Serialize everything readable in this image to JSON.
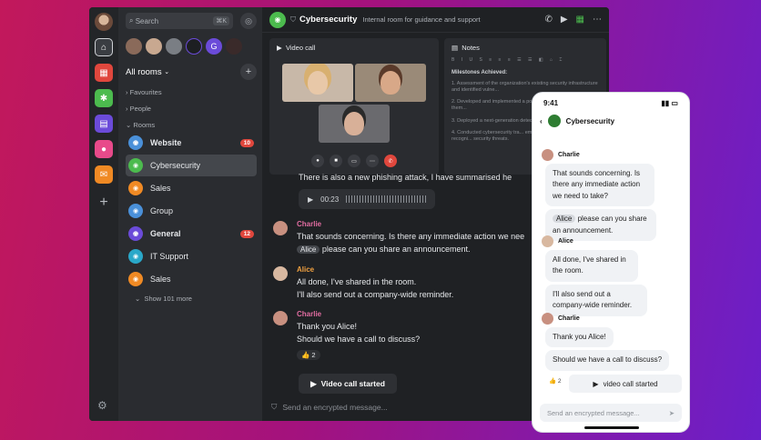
{
  "roomlist": {
    "search_placeholder": "Search",
    "search_shortcut": "⌘K",
    "all_rooms_label": "All rooms",
    "sections": {
      "favourites": "Favourites",
      "people": "People",
      "rooms": "Rooms"
    },
    "recent_g": "G",
    "rooms": [
      {
        "name": "Website",
        "badge": "10",
        "color": "#4a90d9",
        "bold": true
      },
      {
        "name": "Cybersecurity",
        "badge": "",
        "color": "#4cbb4e",
        "active": true
      },
      {
        "name": "Sales",
        "badge": "",
        "color": "#f08a24"
      },
      {
        "name": "Group",
        "badge": "",
        "color": "#4a90d9"
      },
      {
        "name": "General",
        "badge": "12",
        "color": "#6b4bd9",
        "bold": true
      },
      {
        "name": "IT Support",
        "badge": "",
        "color": "#2aa8c9"
      },
      {
        "name": "Sales",
        "badge": "",
        "color": "#f08a24"
      }
    ],
    "show_more": "Show 101 more"
  },
  "header": {
    "room_name": "Cybersecurity",
    "topic": "Internal room for guidance and support"
  },
  "call_panel": {
    "title": "Video call"
  },
  "notes_panel": {
    "title": "Notes",
    "heading": "Milestones Achieved:",
    "items": [
      "1. Assessment of the organization's existing security infrastructure and identified vulne...",
      "2. Developed and implemented a policy and procedures, aligning them...",
      "3. Deployed a next-generation detection system to fortify our n...",
      "4. Conducted cybersecurity tra... employees, focusing on recogni... security threats."
    ]
  },
  "timeline": {
    "partial_text": "There is also a new phishing attack, I have summarised he",
    "voice_duration": "00:23",
    "messages": [
      {
        "sender": "Charlie",
        "color": "#e06ca0",
        "lines": [
          "That sounds concerning. Is there any immediate action we nee"
        ],
        "mention": "Alice",
        "after_mention": "please can you share an announcement."
      },
      {
        "sender": "Alice",
        "color": "#f0a040",
        "lines": [
          "All done, I've shared in the room.",
          "I'll also send out a company-wide reminder."
        ]
      },
      {
        "sender": "Charlie",
        "color": "#e06ca0",
        "lines": [
          "Thank you Alice!",
          "Should we have a call to discuss?"
        ],
        "reaction": "👍 2"
      }
    ],
    "call_started": "Video call started",
    "composer_placeholder": "Send an encrypted message..."
  },
  "phone": {
    "time": "9:41",
    "room_name": "Cybersecurity",
    "messages": [
      {
        "sender": "Charlie",
        "bubbles": [
          "That sounds concerning. Is there any immediate action we need to take?"
        ],
        "mention": "Alice",
        "after_mention": "please can you share an announcement."
      },
      {
        "sender": "Alice",
        "bubbles": [
          "All done, I've shared in the room.",
          "I'll also send out a company-wide reminder."
        ]
      },
      {
        "sender": "Charlie",
        "bubbles": [
          "Thank you Alice!",
          "Should we have a call to discuss?"
        ],
        "reaction": "👍 2"
      }
    ],
    "call_started": "video call started",
    "composer_placeholder": "Send an encrypted message..."
  }
}
